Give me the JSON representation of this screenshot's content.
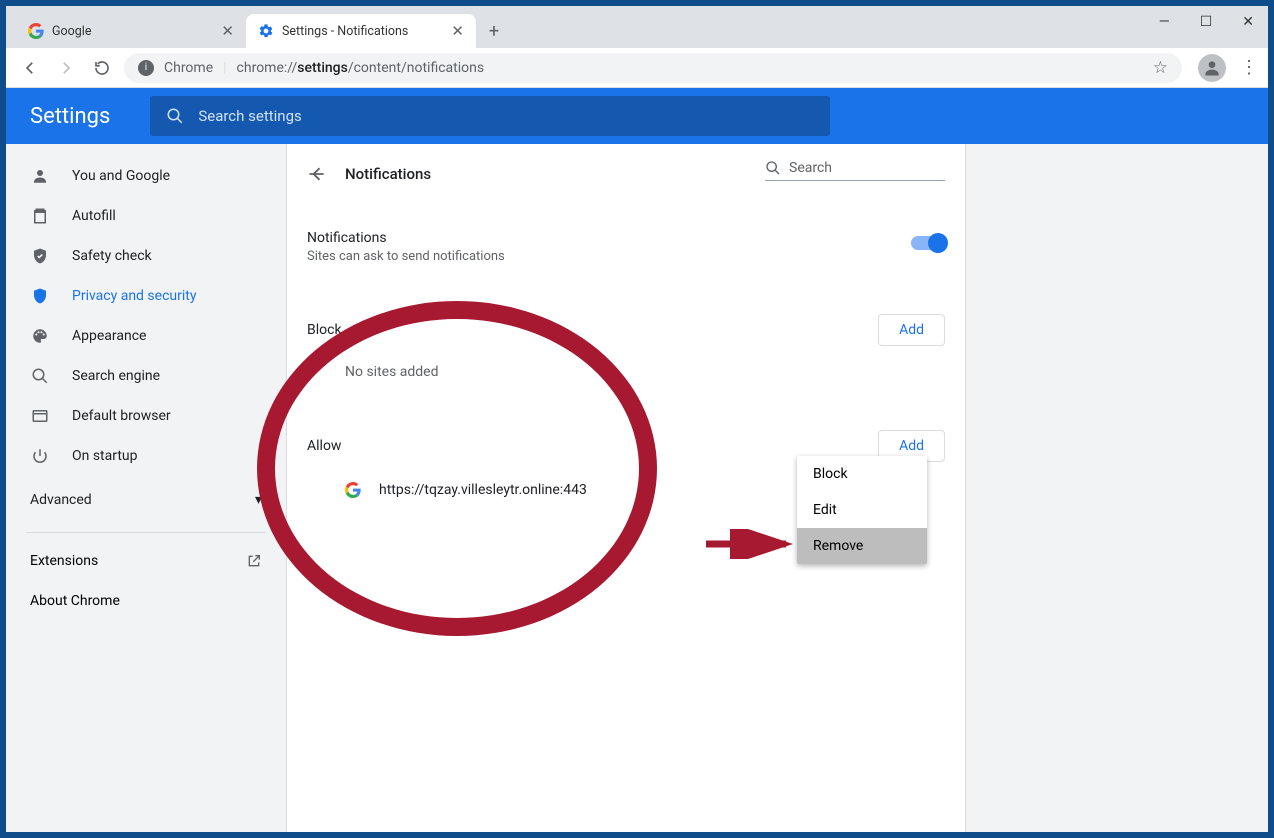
{
  "tabs": [
    {
      "title": "Google"
    },
    {
      "title": "Settings - Notifications"
    }
  ],
  "toolbar": {
    "product": "Chrome",
    "url_prefix": "chrome://",
    "url_bold": "settings",
    "url_suffix": "/content/notifications"
  },
  "header": {
    "title": "Settings",
    "search_placeholder": "Search settings"
  },
  "sidebar": {
    "items": [
      {
        "label": "You and Google"
      },
      {
        "label": "Autofill"
      },
      {
        "label": "Safety check"
      },
      {
        "label": "Privacy and security"
      },
      {
        "label": "Appearance"
      },
      {
        "label": "Search engine"
      },
      {
        "label": "Default browser"
      },
      {
        "label": "On startup"
      }
    ],
    "advanced": "Advanced",
    "extensions": "Extensions",
    "about": "About Chrome"
  },
  "panel": {
    "title": "Notifications",
    "search_placeholder": "Search",
    "notif_title": "Notifications",
    "notif_sub": "Sites can ask to send notifications",
    "block_h": "Block",
    "add_btn": "Add",
    "no_sites": "No sites added",
    "allow_h": "Allow",
    "site_url": "https://tqzay.villesleytr.online:443"
  },
  "menu": {
    "block": "Block",
    "edit": "Edit",
    "remove": "Remove"
  }
}
